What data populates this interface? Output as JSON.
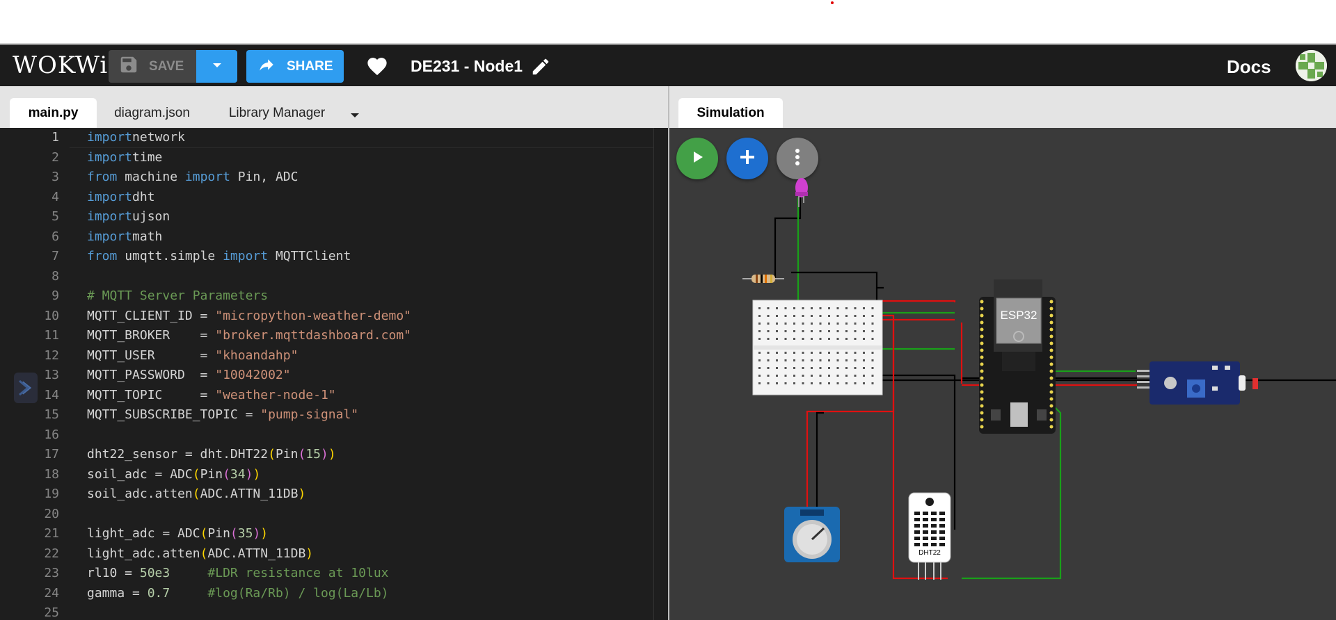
{
  "header": {
    "logo": "WOKWi",
    "save_label": "SAVE",
    "share_label": "SHARE",
    "project_name": "DE231 - Node1",
    "docs_label": "Docs"
  },
  "editor": {
    "tabs": [
      {
        "label": "main.py",
        "active": true
      },
      {
        "label": "diagram.json",
        "active": false
      },
      {
        "label": "Library Manager",
        "active": false
      }
    ],
    "line_numbers": [
      "1",
      "2",
      "3",
      "4",
      "5",
      "6",
      "7",
      "8",
      "9",
      "10",
      "11",
      "12",
      "13",
      "14",
      "15",
      "16",
      "17",
      "18",
      "19",
      "20",
      "21",
      "22",
      "23",
      "24",
      "25"
    ],
    "code": [
      [
        [
          "kw",
          "import"
        ],
        [
          "",
          "network"
        ]
      ],
      [
        [
          "kw",
          "import"
        ],
        [
          "",
          "time"
        ]
      ],
      [
        [
          "kw",
          "from"
        ],
        [
          "",
          " machine "
        ],
        [
          "kw",
          "import"
        ],
        [
          "",
          " Pin, ADC"
        ]
      ],
      [
        [
          "kw",
          "import"
        ],
        [
          "",
          "dht"
        ]
      ],
      [
        [
          "kw",
          "import"
        ],
        [
          "",
          "ujson"
        ]
      ],
      [
        [
          "kw",
          "import"
        ],
        [
          "",
          "math"
        ]
      ],
      [
        [
          "kw",
          "from"
        ],
        [
          "",
          " umqtt.simple "
        ],
        [
          "kw",
          "import"
        ],
        [
          "",
          " MQTTClient"
        ]
      ],
      [],
      [
        [
          "com",
          "# MQTT Server Parameters"
        ]
      ],
      [
        [
          "",
          "MQTT_CLIENT_ID = "
        ],
        [
          "str",
          "\"micropython-weather-demo\""
        ]
      ],
      [
        [
          "",
          "MQTT_BROKER    = "
        ],
        [
          "str",
          "\"broker.mqttdashboard.com\""
        ]
      ],
      [
        [
          "",
          "MQTT_USER      = "
        ],
        [
          "str",
          "\"khoandahp\""
        ]
      ],
      [
        [
          "",
          "MQTT_PASSWORD  = "
        ],
        [
          "str",
          "\"10042002\""
        ]
      ],
      [
        [
          "",
          "MQTT_TOPIC     = "
        ],
        [
          "str",
          "\"weather-node-1\""
        ]
      ],
      [
        [
          "",
          "MQTT_SUBSCRIBE_TOPIC = "
        ],
        [
          "str",
          "\"pump-signal\""
        ]
      ],
      [],
      [
        [
          "",
          "dht22_sensor = dht.DHT22"
        ],
        [
          "p1",
          "("
        ],
        [
          "",
          "Pin"
        ],
        [
          "p2",
          "("
        ],
        [
          "num",
          "15"
        ],
        [
          "p2",
          ")"
        ],
        [
          "p1",
          ")"
        ]
      ],
      [
        [
          "",
          "soil_adc = ADC"
        ],
        [
          "p1",
          "("
        ],
        [
          "",
          "Pin"
        ],
        [
          "p2",
          "("
        ],
        [
          "num",
          "34"
        ],
        [
          "p2",
          ")"
        ],
        [
          "p1",
          ")"
        ]
      ],
      [
        [
          "",
          "soil_adc.atten"
        ],
        [
          "p1",
          "("
        ],
        [
          "",
          "ADC.ATTN_11DB"
        ],
        [
          "p1",
          ")"
        ]
      ],
      [],
      [
        [
          "",
          "light_adc = ADC"
        ],
        [
          "p1",
          "("
        ],
        [
          "",
          "Pin"
        ],
        [
          "p2",
          "("
        ],
        [
          "num",
          "35"
        ],
        [
          "p2",
          ")"
        ],
        [
          "p1",
          ")"
        ]
      ],
      [
        [
          "",
          "light_adc.atten"
        ],
        [
          "p1",
          "("
        ],
        [
          "",
          "ADC.ATTN_11DB"
        ],
        [
          "p1",
          ")"
        ]
      ],
      [
        [
          "",
          "rl10 = "
        ],
        [
          "num",
          "50e3"
        ],
        [
          "",
          "     "
        ],
        [
          "com",
          "#LDR resistance at 10lux"
        ]
      ],
      [
        [
          "",
          "gamma = "
        ],
        [
          "num",
          "0.7"
        ],
        [
          "",
          "     "
        ],
        [
          "com",
          "#log(Ra/Rb) / log(La/Lb)"
        ]
      ],
      []
    ]
  },
  "simulation": {
    "tab_label": "Simulation",
    "esp32_label": "ESP32",
    "dht22_label": "DHT22"
  },
  "colors": {
    "accent_blue": "#2f9df0",
    "play_green": "#43a047",
    "add_blue": "#1e6fd0",
    "more_gray": "#808080",
    "editor_bg": "#1e1e1e",
    "sim_bg": "#3a3a3a"
  },
  "icons": [
    "save-icon",
    "dropdown-caret-icon",
    "share-icon",
    "heart-icon",
    "pencil-icon",
    "play-icon",
    "plus-icon",
    "more-vert-icon"
  ]
}
